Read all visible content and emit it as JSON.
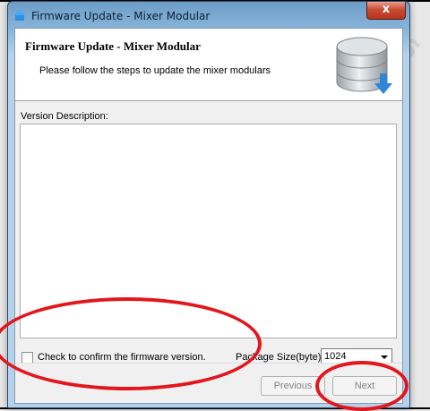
{
  "window": {
    "title": "Firmware Update - Mixer Modular",
    "close_label": "x"
  },
  "header": {
    "title": "Firmware Update - Mixer Modular",
    "subtitle": "Please follow the steps to update the mixer modulars",
    "icon": "database-download-icon"
  },
  "body": {
    "version_label": "Version Description:",
    "version_text": "",
    "confirm_label": "Check to confirm the firmware version.",
    "confirm_checked": false,
    "package_label": "Package Size(byte):",
    "package_value": "1024"
  },
  "buttons": {
    "previous": "Previous",
    "next": "Next",
    "enabled": false
  },
  "colors": {
    "annotation": "#e2161d",
    "titlebar": "#86b3d9",
    "close": "#c84c32"
  }
}
